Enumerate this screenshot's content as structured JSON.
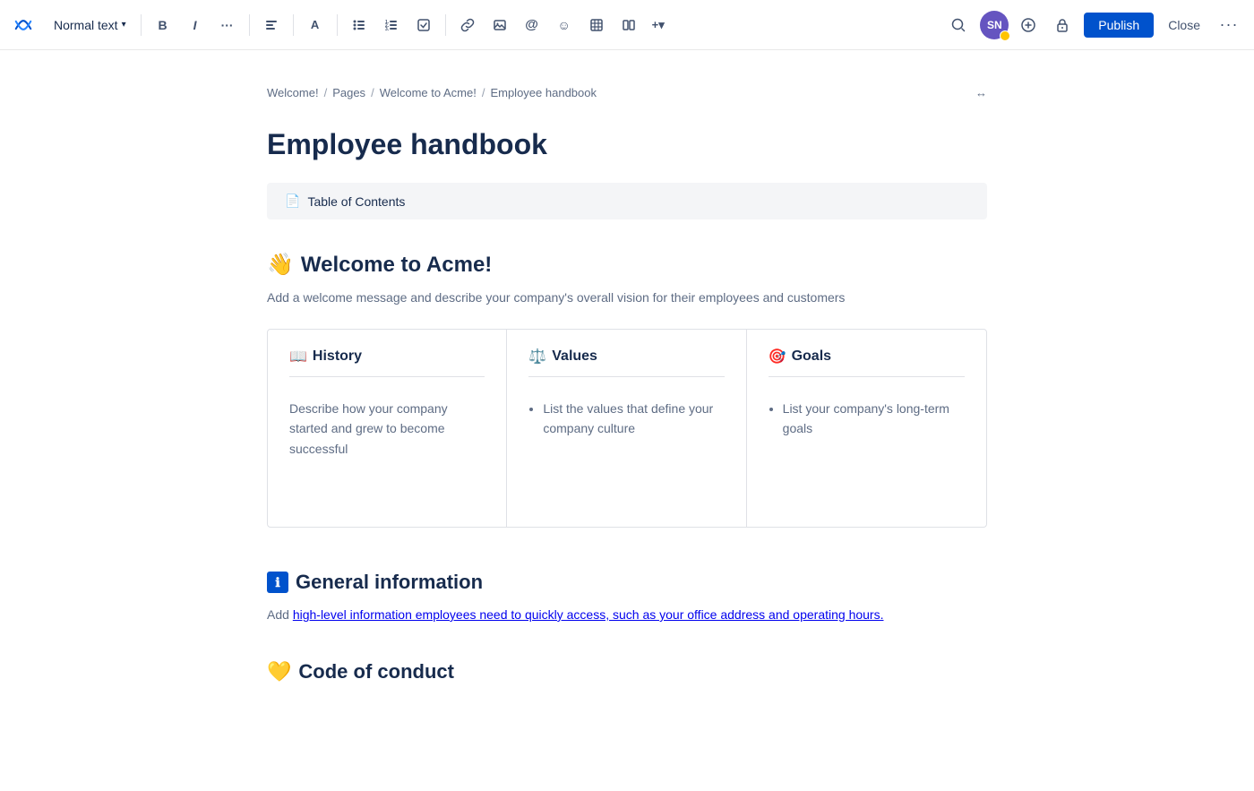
{
  "toolbar": {
    "logo_label": "Confluence",
    "text_style": "Normal text",
    "bold_label": "B",
    "italic_label": "I",
    "more_format_label": "···",
    "align_label": "≡",
    "color_label": "A",
    "bullet_label": "≡",
    "numbered_label": "≡",
    "task_label": "☑",
    "link_label": "⊘",
    "image_label": "⬜",
    "mention_label": "@",
    "emoji_label": "☺",
    "table_label": "⊞",
    "columns_label": "⊟",
    "insert_label": "+▾",
    "search_label": "🔍",
    "avatar_initials": "SN",
    "add_label": "+",
    "restrict_label": "🔒",
    "publish_label": "Publish",
    "close_label": "Close",
    "options_label": "···"
  },
  "breadcrumb": {
    "items": [
      {
        "label": "Welcome!",
        "href": "#"
      },
      {
        "label": "Pages",
        "href": "#"
      },
      {
        "label": "Welcome to Acme!",
        "href": "#"
      },
      {
        "label": "Employee handbook",
        "href": "#"
      }
    ],
    "expand_label": "↔"
  },
  "page": {
    "title": "Employee handbook",
    "toc_label": "Table of Contents",
    "sections": [
      {
        "id": "welcome",
        "emoji": "👋",
        "heading": "Welcome to Acme!",
        "description": "Add a welcome message and describe your company's overall vision for their employees and customers",
        "cards": [
          {
            "id": "history",
            "emoji": "📖",
            "title": "History",
            "body_text": "Describe how your company started and grew to become successful",
            "body_type": "text"
          },
          {
            "id": "values",
            "emoji": "⚖️",
            "title": "Values",
            "body_items": [
              "List the values that define your company culture"
            ],
            "body_type": "list"
          },
          {
            "id": "goals",
            "emoji": "🎯",
            "title": "Goals",
            "body_items": [
              "List your company's long-term goals"
            ],
            "body_type": "list"
          }
        ]
      },
      {
        "id": "general-info",
        "emoji": "ℹ️",
        "heading": "General information",
        "description": "Add high-level information employees need to quickly access, such as your office address and operating hours."
      },
      {
        "id": "code-of-conduct",
        "emoji": "💛",
        "heading": "Code of conduct",
        "description": ""
      }
    ]
  }
}
